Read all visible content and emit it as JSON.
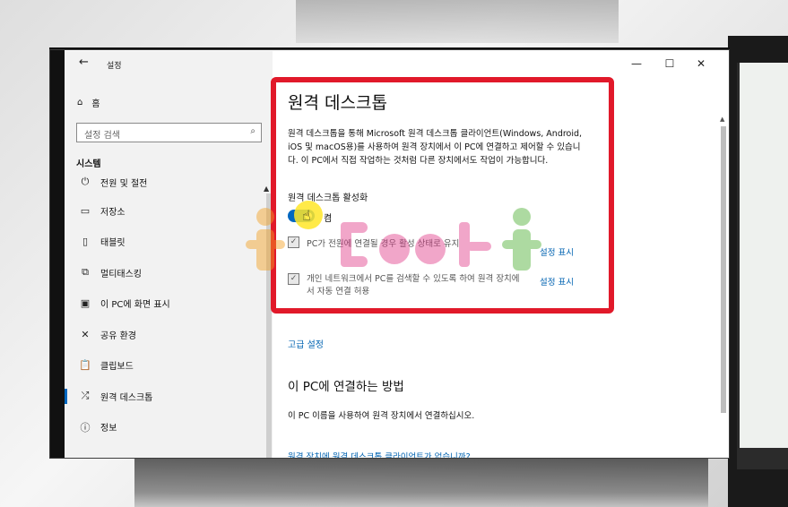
{
  "window": {
    "back_glyph": "←",
    "title": "설정",
    "minimize_glyph": "—",
    "maximize_glyph": "☐",
    "close_glyph": "✕"
  },
  "sidebar": {
    "home_label": "홈",
    "search_placeholder": "설정 검색",
    "section_title": "시스템",
    "items": [
      {
        "label": "전원 및 절전",
        "icon": "power-icon"
      },
      {
        "label": "저장소",
        "icon": "storage-icon"
      },
      {
        "label": "태블릿",
        "icon": "tablet-icon"
      },
      {
        "label": "멀티태스킹",
        "icon": "multitasking-icon"
      },
      {
        "label": "이 PC에 화면 표시",
        "icon": "project-icon"
      },
      {
        "label": "공유 환경",
        "icon": "shared-experiences-icon"
      },
      {
        "label": "클립보드",
        "icon": "clipboard-icon"
      },
      {
        "label": "원격 데스크톱",
        "icon": "remote-desktop-icon",
        "active": true
      },
      {
        "label": "정보",
        "icon": "info-icon"
      }
    ]
  },
  "main": {
    "title": "원격 데스크톱",
    "description": "원격 데스크톱을 통해 Microsoft 원격 데스크톱 클라이언트(Windows, Android, iOS 및 macOS용)를 사용하여 원격 장치에서 이 PC에 연결하고 제어할 수 있습니다. 이 PC에서 직접 작업하는 것처럼 다른 장치에서도 작업이 가능합니다.",
    "toggle_label": "원격 데스크톱 활성화",
    "toggle_state": "켬",
    "option1": "PC가 전원에 연결될 경우 활성 상태로 유지",
    "option2": "개인 네트워크에서 PC를 검색할 수 있도록 하여 원격 장치에서 자동 연결 허용",
    "show_settings": "설정 표시",
    "advanced": "고급 설정",
    "how_to_heading": "이 PC에 연결하는 방법",
    "how_to_text": "이 PC 이름을 사용하여 원격 장치에서 연결하십시오.",
    "no_client_link": "원격 장치에 원격 데스크톱 클라이언트가 없습니까?"
  },
  "colors": {
    "accent": "#0067c0",
    "highlight_frame": "#e1192a",
    "link": "#0063b1"
  }
}
